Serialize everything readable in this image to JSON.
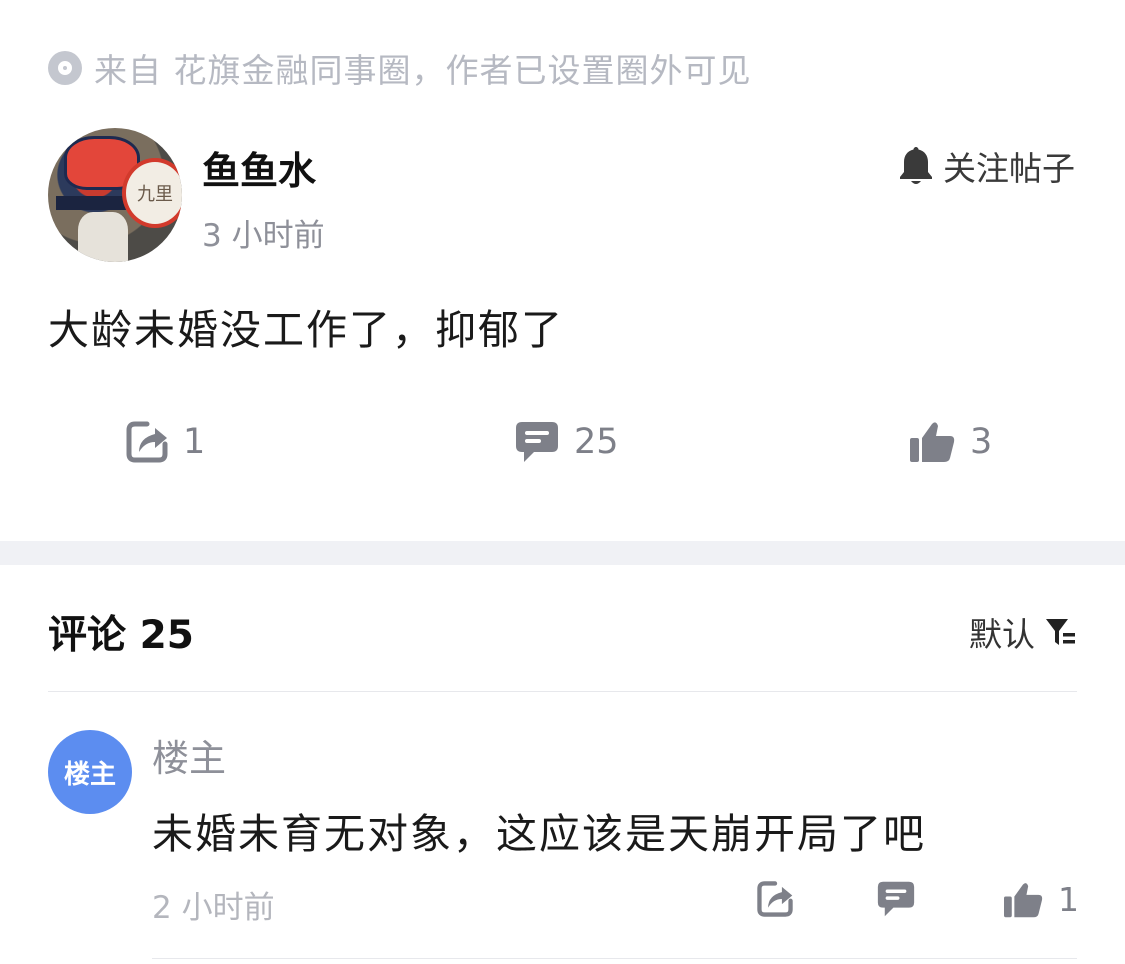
{
  "source": {
    "icon": "circle-dot-icon",
    "text": "来自 花旗金融同事圈，作者已设置圈外可见"
  },
  "post": {
    "author": "鱼鱼水",
    "avatar_icon": "user-avatar",
    "avatar_text": "九里",
    "time": "3 小时前",
    "follow_label": "关注帖子",
    "follow_icon": "bell-icon",
    "body": "大龄未婚没工作了，抑郁了",
    "actions": {
      "share_count": "1",
      "comment_count": "25",
      "like_count": "3"
    }
  },
  "comments": {
    "title": "评论 25",
    "sort_label": "默认",
    "sort_icon": "filter-icon",
    "items": [
      {
        "avatar_label": "楼主",
        "name": "楼主",
        "text": "未婚未育无对象，这应该是天崩开局了吧",
        "time": "2 小时前",
        "like_count": "1"
      }
    ]
  },
  "colors": {
    "accent": "#5c8df0",
    "muted_text": "#8e9099",
    "icon_gray": "#7e8089",
    "band": "#f0f1f5"
  }
}
